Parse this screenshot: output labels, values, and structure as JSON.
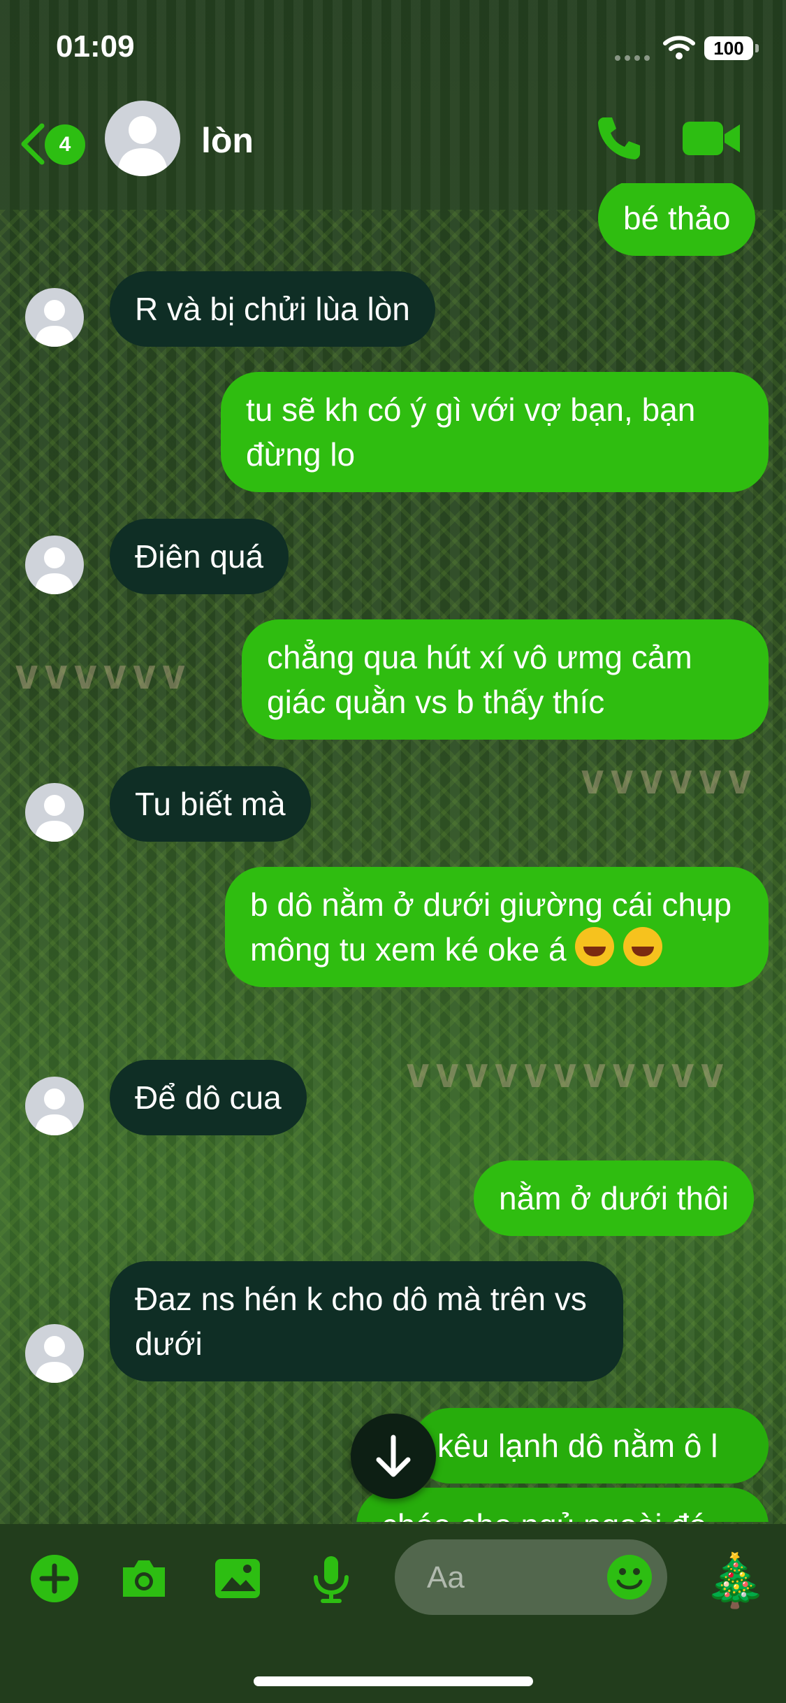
{
  "status_bar": {
    "time": "01:09",
    "battery": "100"
  },
  "header": {
    "unread_count": "4",
    "contact_name": "lòn",
    "icons": {
      "back": "chevron-left-icon",
      "call": "phone-icon",
      "video": "video-camera-icon"
    }
  },
  "messages": [
    {
      "side": "out",
      "text": "bé thảo"
    },
    {
      "side": "in",
      "text": "R và bị chửi lùa lòn"
    },
    {
      "side": "out",
      "text": "tu sẽ kh có ý gì với vợ bạn, bạn đừng lo"
    },
    {
      "side": "in",
      "text": "Điên quá"
    },
    {
      "side": "out",
      "text": "chẳng qua hút xí vô ưmg cảm giác quằn vs b thấy thíc"
    },
    {
      "side": "in",
      "text": "Tu biết mà"
    },
    {
      "side": "out",
      "text": "b dô nằm ở dưới giường cái chụp mông tu xem ké oke á"
    },
    {
      "side": "in",
      "text": "Để dô cua"
    },
    {
      "side": "out",
      "text": "nằm ở dưới thôi"
    },
    {
      "side": "in",
      "text": "Đaz ns hén k cho dô mà trên vs dưới"
    },
    {
      "side": "out",
      "text": "kêu lạnh dô nằm ô l"
    },
    {
      "side": "out",
      "text": "chóe cho ngủ ngoài đó"
    }
  ],
  "composer": {
    "placeholder": "Aa",
    "icons": [
      "plus-icon",
      "camera-icon",
      "image-icon",
      "microphone-icon",
      "smiley-icon",
      "christmas-tree-icon"
    ]
  },
  "colors": {
    "accent": "#2dbe12",
    "outgoing_bubble": "#2fbd10",
    "incoming_bubble": "#0f2e25"
  }
}
